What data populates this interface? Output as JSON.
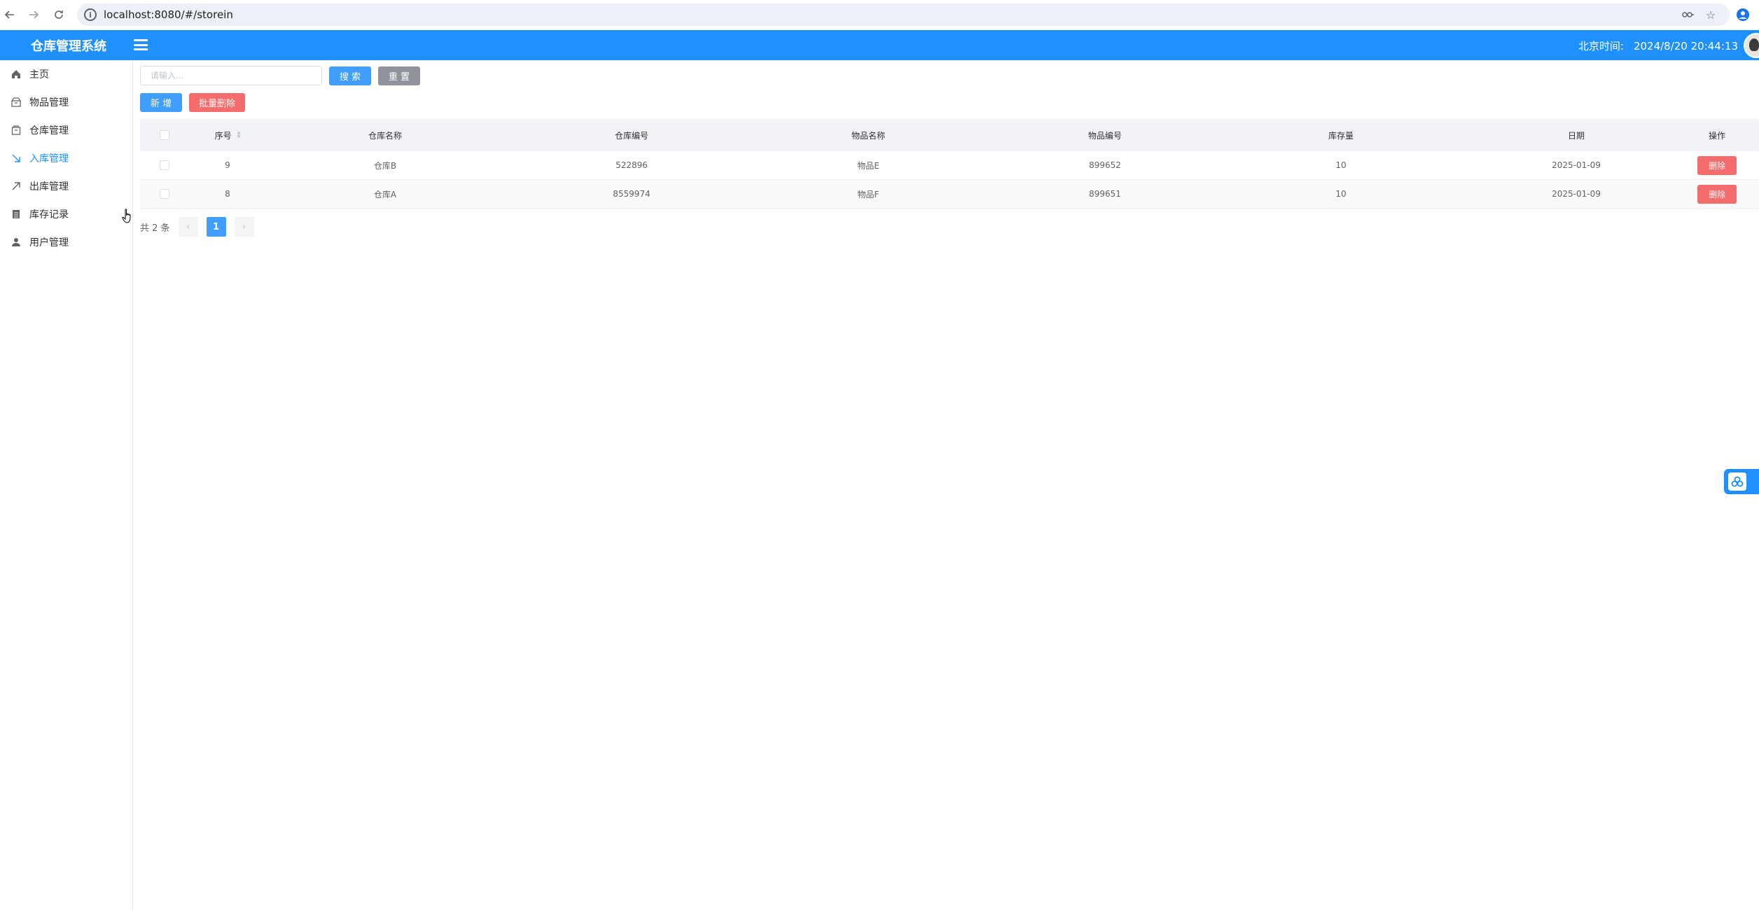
{
  "browser": {
    "url": "localhost:8080/#/storein",
    "back_icon": "arrow-left-icon",
    "forward_icon": "arrow-right-icon",
    "reload_icon": "reload-icon"
  },
  "header": {
    "title": "仓库管理系统",
    "clock_label": "北京时间:",
    "clock_value": "2024/8/20 20:44:13",
    "accent": "#1e90ff"
  },
  "sidebar": {
    "items": [
      {
        "label": "主页",
        "icon": "home-icon"
      },
      {
        "label": "物品管理",
        "icon": "box-icon"
      },
      {
        "label": "仓库管理",
        "icon": "warehouse-icon"
      },
      {
        "label": "入库管理",
        "icon": "arrow-in-icon",
        "active": true
      },
      {
        "label": "出库管理",
        "icon": "arrow-out-icon"
      },
      {
        "label": "库存记录",
        "icon": "record-icon"
      },
      {
        "label": "用户管理",
        "icon": "user-icon"
      }
    ]
  },
  "toolbar": {
    "search_placeholder": "请输入...",
    "search_label": "搜 索",
    "reset_label": "重 置",
    "add_label": "新 增",
    "batch_delete_label": "批量删除"
  },
  "table": {
    "columns": [
      "序号",
      "仓库名称",
      "仓库编号",
      "物品名称",
      "物品编号",
      "库存量",
      "日期",
      "操作"
    ],
    "rows": [
      {
        "id": "9",
        "warehouse_name": "仓库B",
        "warehouse_no": "522896",
        "item_name": "物品E",
        "item_no": "899652",
        "stock": "10",
        "date": "2025-01-09",
        "action": "删除"
      },
      {
        "id": "8",
        "warehouse_name": "仓库A",
        "warehouse_no": "8559974",
        "item_name": "物品F",
        "item_no": "899651",
        "stock": "10",
        "date": "2025-01-09",
        "action": "删除"
      }
    ]
  },
  "pagination": {
    "total_label": "共 2 条",
    "current_page": "1",
    "prev_icon": "chevron-left-icon",
    "next_icon": "chevron-right-icon"
  }
}
